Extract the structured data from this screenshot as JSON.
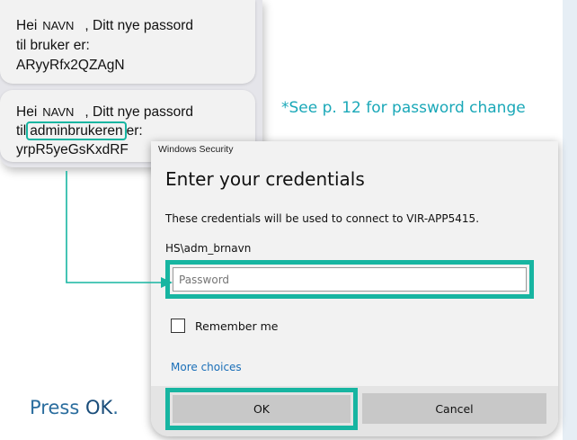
{
  "sms": {
    "msg1": {
      "greeting": "Hei",
      "name": "NAVN",
      "line1_rest": ", Ditt nye passord",
      "line2": "til bruker er:",
      "password": "ARyyRfx2QZAgN"
    },
    "msg2": {
      "greeting": "Hei",
      "name": "NAVN",
      "line1_rest": ", Ditt nye passord",
      "line2_pre": "til",
      "highlight": "adminbrukeren",
      "line2_post": "er:",
      "password": "yrpR5yeGsKxdRF"
    }
  },
  "note": "*See p. 12  for password change",
  "dialog": {
    "caption": "Windows Security",
    "title": "Enter your credentials",
    "description": "These credentials will be used to connect to VIR-APP5415.",
    "username": "HS\\adm_brnavn",
    "password_placeholder": "Password",
    "remember_label": "Remember me",
    "more_choices": "More choices",
    "ok_label": "OK",
    "cancel_label": "Cancel"
  },
  "instruction": {
    "prefix": "Press ",
    "ok": "OK",
    "suffix": "."
  },
  "colors": {
    "highlight": "#17b5a1",
    "note": "#1aa8b8",
    "link": "#1a6fb8"
  }
}
